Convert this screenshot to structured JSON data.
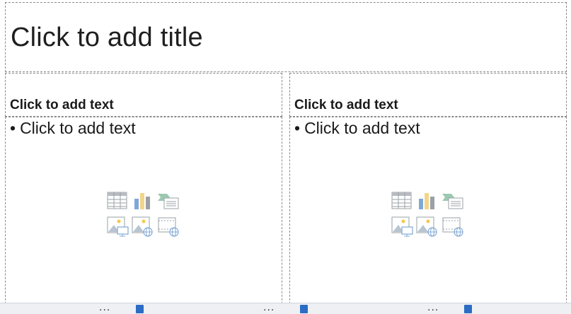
{
  "slide": {
    "title_placeholder": "Click to add title",
    "left_column": {
      "header": "Click to add text",
      "bullet": "Click to add text"
    },
    "right_column": {
      "header": "Click to add text",
      "bullet": "Click to add text"
    },
    "insert_icons": [
      "table-icon",
      "chart-icon",
      "smartart-icon",
      "picture-icon",
      "online-picture-icon",
      "video-icon"
    ]
  },
  "colors": {
    "placeholder_border": "#8a8a8a",
    "icon_gray": "#9aa0a6",
    "icon_blue": "#7fa8d6",
    "icon_yellow": "#f2c94c",
    "icon_green": "#7fbf9a"
  },
  "taskbar": {
    "more_label": "..."
  }
}
